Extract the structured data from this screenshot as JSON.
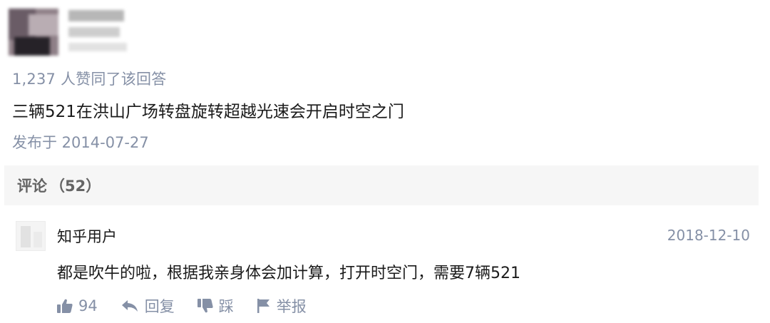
{
  "answer": {
    "vote_summary": "1,237 人赞同了该回答",
    "content": "三辆521在洪山广场转盘旋转超越光速会开启时空之门",
    "published": "发布于 2014-07-27"
  },
  "comments": {
    "label": "评论",
    "count": "（52）",
    "items": [
      {
        "user": "知乎用户",
        "date": "2018-12-10",
        "text": "都是吹牛的啦，根据我亲身体会加计算，打开时空门，需要7辆521",
        "likes": "94",
        "reply_label": "回复",
        "dislike_label": "踩",
        "report_label": "举报"
      }
    ]
  },
  "colors": {
    "meta_gray": "#8590a6",
    "header_bg": "#f6f6f6",
    "text": "#1a1a1a"
  },
  "icons": [
    "thumbs-up-icon",
    "reply-arrow-icon",
    "thumbs-down-icon",
    "flag-icon"
  ]
}
